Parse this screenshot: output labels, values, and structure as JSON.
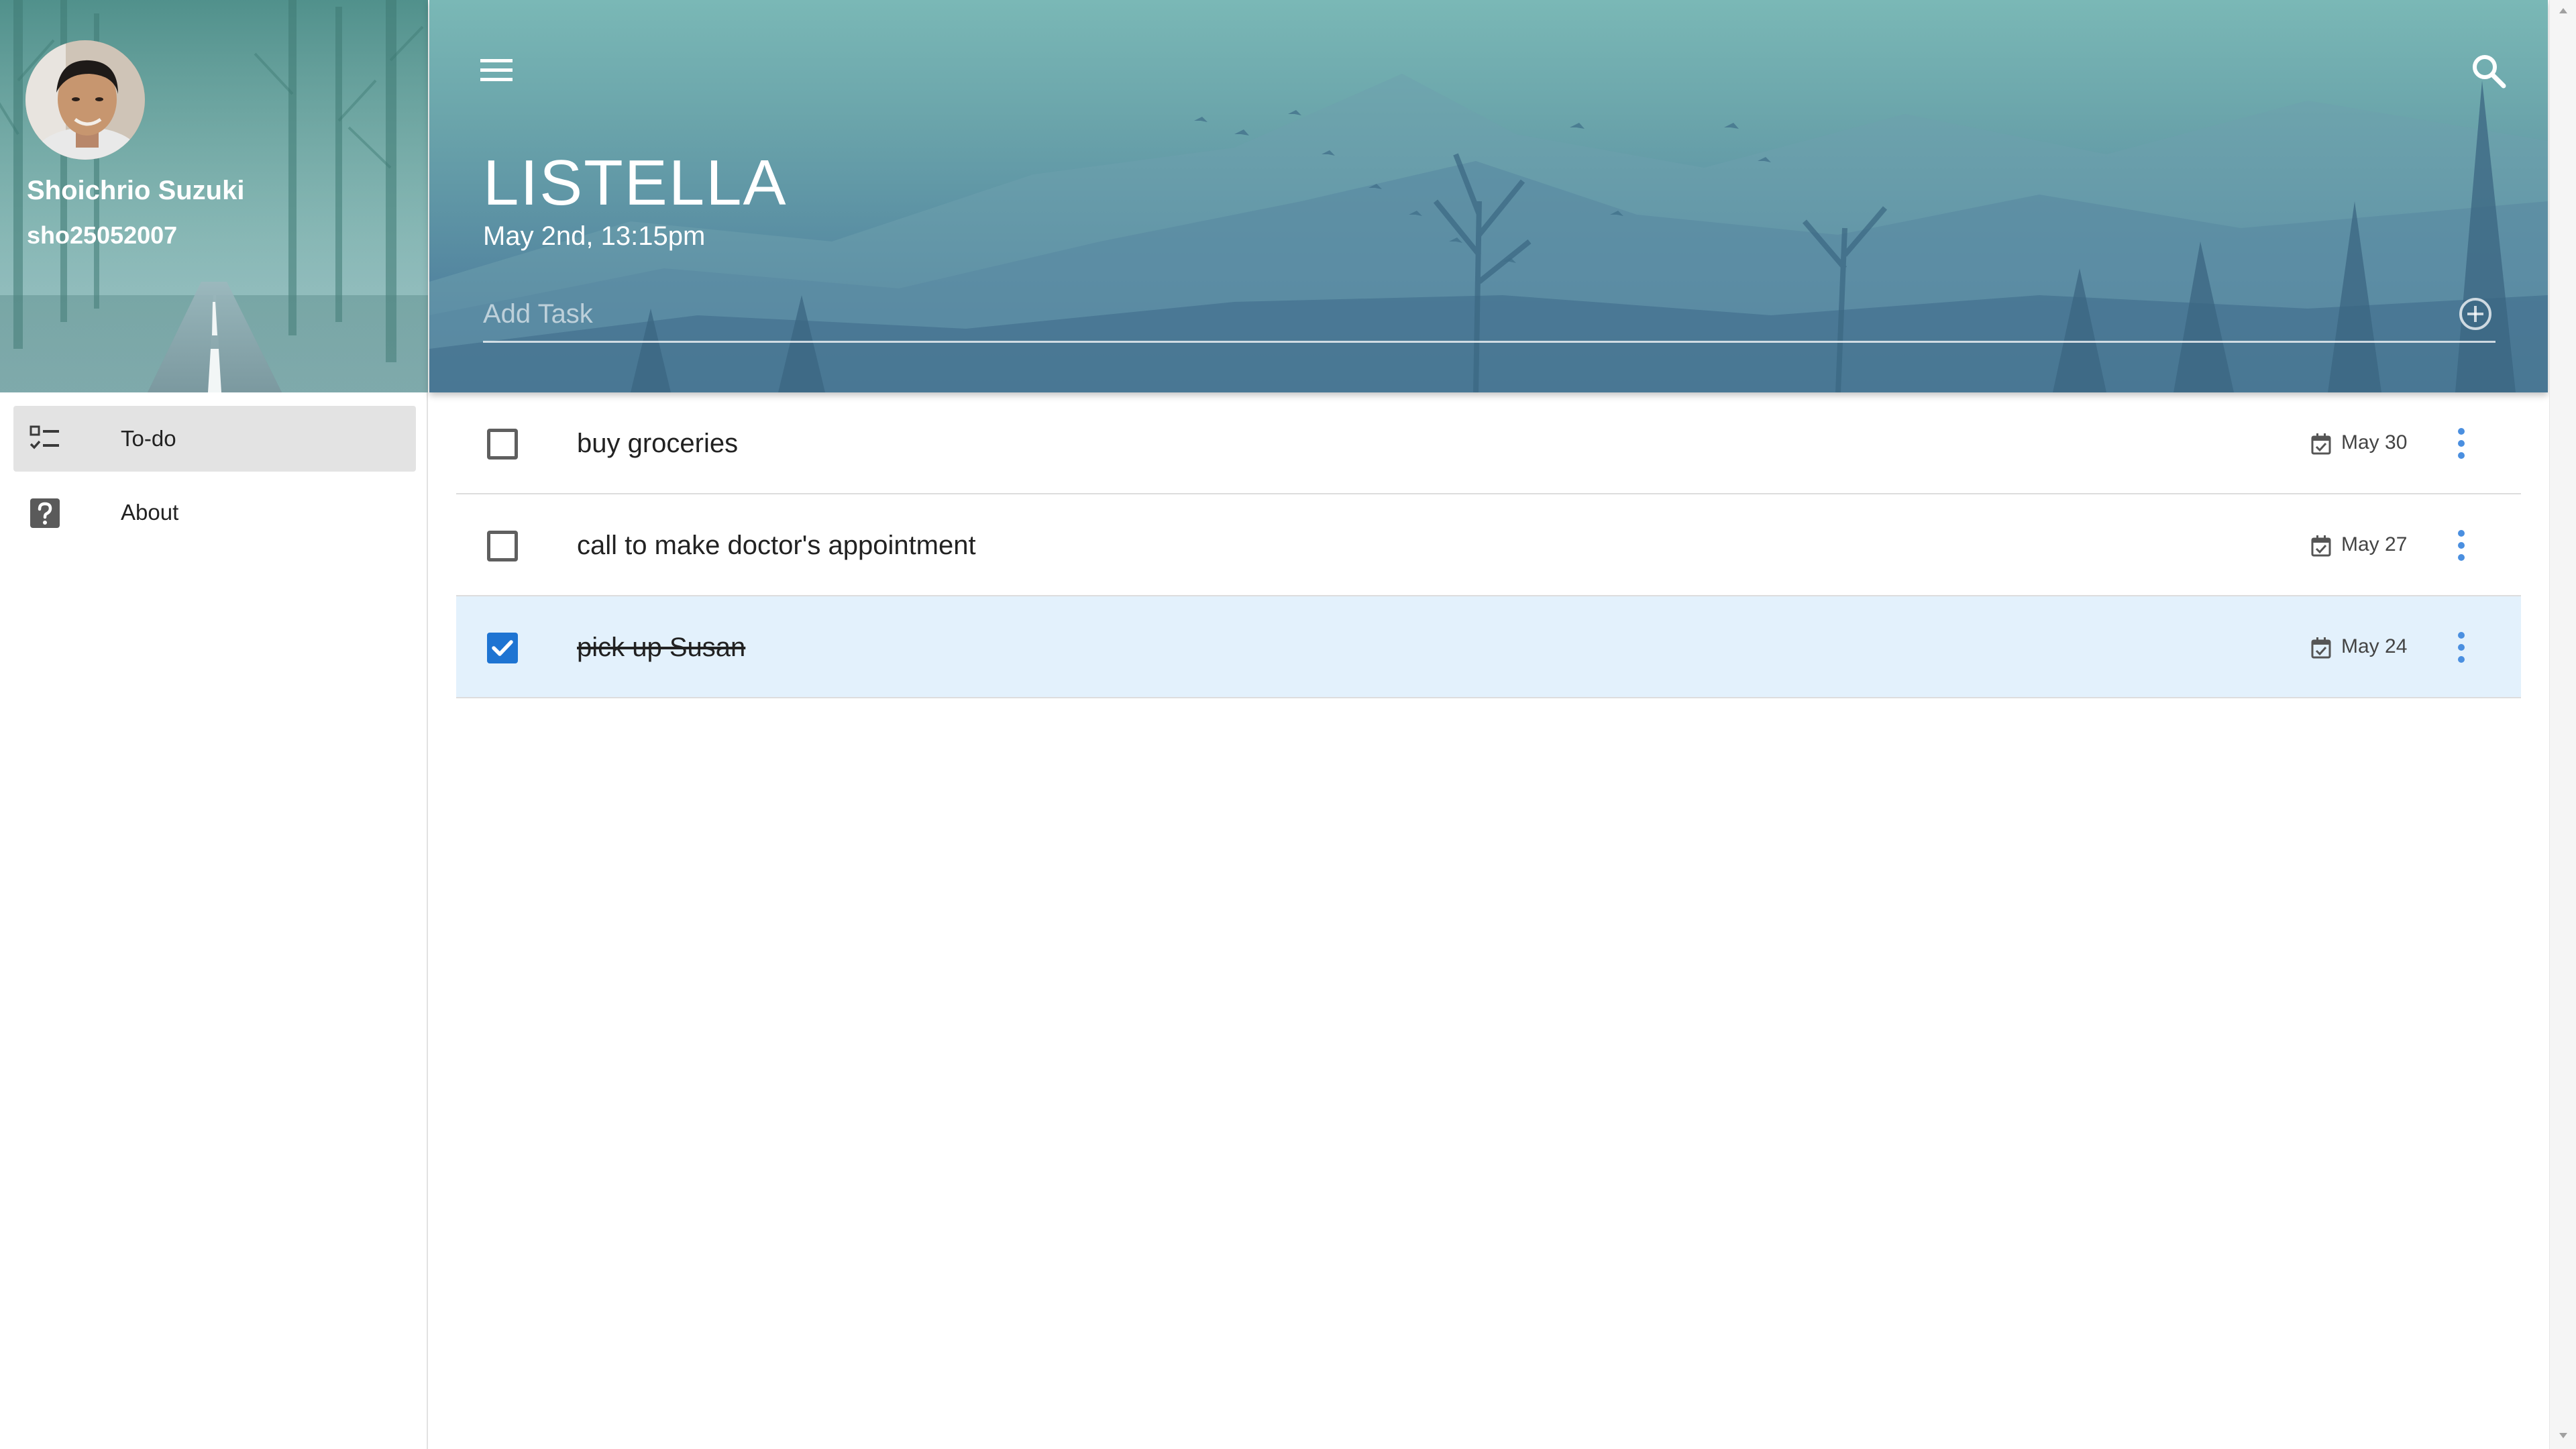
{
  "user": {
    "name": "Shoichrio Suzuki",
    "handle": "sho25052007"
  },
  "nav": {
    "items": [
      {
        "label": "To-do",
        "icon": "checklist-icon",
        "active": true
      },
      {
        "label": "About",
        "icon": "help-icon",
        "active": false
      }
    ]
  },
  "header": {
    "title": "LISTELLA",
    "date": "May 2nd, 13:15pm",
    "add_task_placeholder": "Add Task"
  },
  "tasks": [
    {
      "text": "buy groceries",
      "due": "May 30",
      "done": false
    },
    {
      "text": "call to make doctor's appointment",
      "due": "May 27",
      "done": false
    },
    {
      "text": "pick up Susan",
      "due": "May 24",
      "done": true
    }
  ],
  "colors": {
    "accent": "#1e74d2",
    "more_icon": "#4a8fe0",
    "done_row": "#e3f1fc",
    "active_nav": "#e3e3e3"
  }
}
